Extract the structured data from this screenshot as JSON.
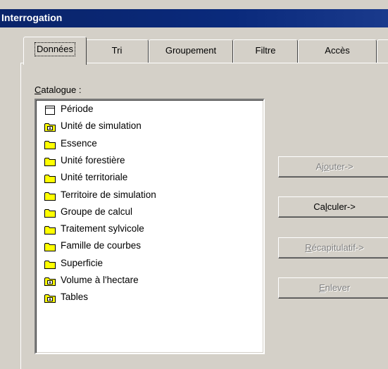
{
  "window": {
    "title": "Interrogation"
  },
  "tabs": [
    {
      "label": "Données",
      "active": true
    },
    {
      "label": "Tri",
      "active": false
    },
    {
      "label": "Groupement",
      "active": false
    },
    {
      "label": "Filtre",
      "active": false
    },
    {
      "label": "Accès",
      "active": false
    }
  ],
  "catalogue": {
    "label_mnemonic": "C",
    "label_rest": "atalogue :",
    "items": [
      {
        "label": "Période",
        "icon": "table-icon"
      },
      {
        "label": "Unité de simulation",
        "icon": "folder-plus-icon"
      },
      {
        "label": "Essence",
        "icon": "folder-icon"
      },
      {
        "label": "Unité forestière",
        "icon": "folder-icon"
      },
      {
        "label": "Unité territoriale",
        "icon": "folder-icon"
      },
      {
        "label": "Territoire de simulation",
        "icon": "folder-icon"
      },
      {
        "label": "Groupe de calcul",
        "icon": "folder-icon"
      },
      {
        "label": "Traitement sylvicole",
        "icon": "folder-icon"
      },
      {
        "label": "Famille de courbes",
        "icon": "folder-icon"
      },
      {
        "label": "Superficie",
        "icon": "folder-icon"
      },
      {
        "label": "Volume à l'hectare",
        "icon": "folder-plus-icon"
      },
      {
        "label": "Tables",
        "icon": "folder-plus-icon"
      }
    ]
  },
  "buttons": {
    "ajouter": {
      "pre": "Aj",
      "u": "o",
      "post": "uter->",
      "enabled": false
    },
    "calculer": {
      "pre": "Ca",
      "u": "l",
      "post": "culer->",
      "enabled": true
    },
    "recapitulatif": {
      "pre": "",
      "u": "R",
      "post": "écapitulatif->",
      "enabled": false
    },
    "enlever": {
      "pre": "",
      "u": "E",
      "post": "nlever",
      "enabled": false
    }
  },
  "colors": {
    "titlebar": "#0a246a",
    "face": "#d4d0c8",
    "folder": "#ffff00"
  }
}
